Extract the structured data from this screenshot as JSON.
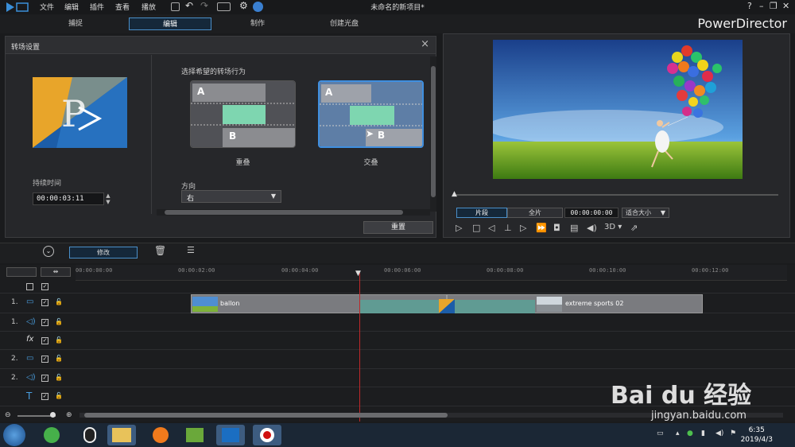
{
  "titlebar": {
    "menus": [
      "文件",
      "编辑",
      "插件",
      "查看",
      "播放"
    ],
    "title": "未命名的新项目*",
    "help": "?"
  },
  "modes": {
    "tabs": [
      "捕捉",
      "编辑",
      "制作",
      "创建光盘"
    ],
    "active": 1,
    "brand": "PowerDirector"
  },
  "panel": {
    "title": "转场设置",
    "duration_label": "持续时间",
    "duration_value": "00:00:03:11",
    "choose_label": "选择希望的转场行为",
    "options": [
      {
        "label": "重叠",
        "a": "A",
        "b": "B"
      },
      {
        "label": "交叠",
        "a": "A",
        "b": "B"
      }
    ],
    "direction_label": "方向",
    "direction_value": "右",
    "reset_label": "重置"
  },
  "preview": {
    "seg_a": "片段",
    "seg_b": "全片",
    "time": "00:00:00:00",
    "zoom": "适合大小",
    "threed": "3D"
  },
  "toolbar": {
    "modify_label": "修改"
  },
  "timeline": {
    "ticks": [
      "00:00:00:00",
      "00:00:02:00",
      "00:00:04:00",
      "00:00:06:00",
      "00:00:08:00",
      "00:00:10:00",
      "00:00:12:00"
    ],
    "tracks": [
      {
        "label": "1.",
        "icon": "video"
      },
      {
        "label": "1.",
        "icon": "audio"
      },
      {
        "label": "",
        "icon": "fx",
        "symbol": "fx"
      },
      {
        "label": "2.",
        "icon": "video"
      },
      {
        "label": "2.",
        "icon": "audio"
      },
      {
        "label": "",
        "icon": "title",
        "symbol": "T"
      }
    ],
    "clips": [
      {
        "name": "ballon"
      },
      {
        "name": "extreme sports 02"
      }
    ]
  },
  "taskbar": {
    "time": "6:35",
    "date": "2019/4/3"
  },
  "watermark": {
    "brand": "Bai du 经验",
    "url": "jingyan.baidu.com"
  },
  "colors": {
    "accent": "#4a8fc9",
    "playhead": "#c0282a",
    "transition": "#7ed6b0"
  }
}
